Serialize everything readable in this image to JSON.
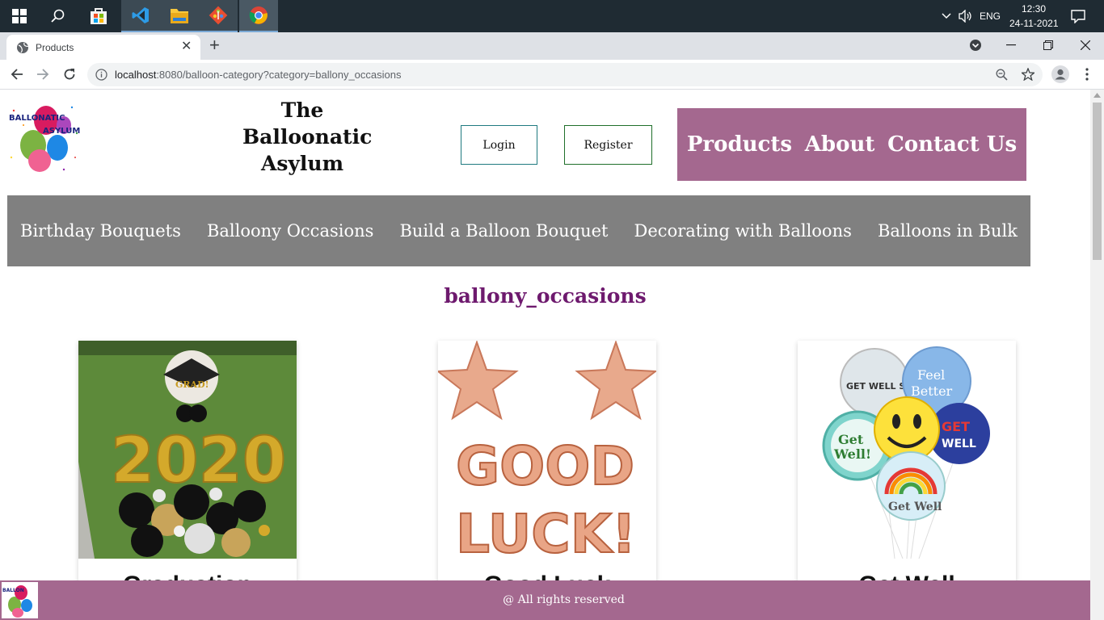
{
  "taskbar": {
    "apps": [
      "windows-start",
      "search",
      "microsoft-store",
      "vscode",
      "file-explorer",
      "git",
      "chrome"
    ],
    "language": "ENG",
    "time": "12:30",
    "date": "24-11-2021"
  },
  "browser": {
    "tab_title": "Products",
    "url_host": "localhost",
    "url_rest": ":8080/balloon-category?category=ballony_occasions"
  },
  "header": {
    "brand_line1": "The",
    "brand_line2": "Balloonatic",
    "brand_line3": "Asylum",
    "login_label": "Login",
    "register_label": "Register",
    "nav": [
      "Products",
      "About",
      "Contact Us"
    ]
  },
  "categories": [
    "Birthday Bouquets",
    "Balloony Occasions",
    "Build a Balloon Bouquet",
    "Decorating with Balloons",
    "Balloons in Bulk"
  ],
  "category_heading": "ballony_occasions",
  "products": [
    {
      "title": "Graduation"
    },
    {
      "title": "Good Luck"
    },
    {
      "title": "Get Well"
    }
  ],
  "footer": {
    "text": "@ All rights reserved"
  },
  "colors": {
    "accent": "#a4688f",
    "category_bar": "#808080",
    "heading": "#6e1a6e"
  }
}
